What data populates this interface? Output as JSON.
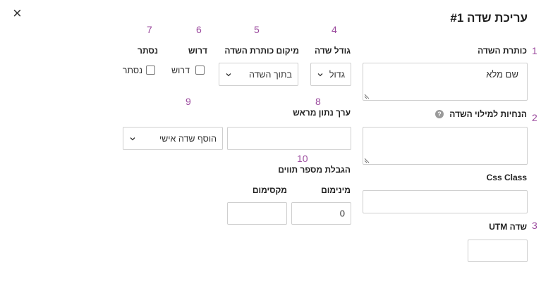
{
  "dialog": {
    "title": "עריכת שדה #1",
    "close_glyph": "×"
  },
  "markers": {
    "m1": "1",
    "m2": "2",
    "m3": "3",
    "m4": "4",
    "m5": "5",
    "m6": "6",
    "m7": "7",
    "m8": "8",
    "m9": "9",
    "m10": "10"
  },
  "fields": {
    "field_title": {
      "label": "כותרת השדה",
      "value": "שם מלא"
    },
    "instructions": {
      "label": "הנחיות למילוי השדה",
      "value": "",
      "help_glyph": "?"
    },
    "css_class": {
      "label": "Css Class",
      "value": ""
    },
    "utm": {
      "label": "שדה UTM",
      "value": ""
    },
    "field_size": {
      "label": "גודל שדה",
      "selected": "גדול"
    },
    "title_position": {
      "label": "מיקום כותרת השדה",
      "selected": "בתוך השדה"
    },
    "required": {
      "label": "דרוש",
      "checkbox_label": "דרוש",
      "checked": false
    },
    "hidden": {
      "label": "נסתר",
      "checkbox_label": "נסתר",
      "checked": false
    },
    "default_value": {
      "label": "ערך נתון מראש",
      "value": ""
    },
    "personal_field": {
      "selected": "הוסף שדה אישי"
    },
    "char_limit": {
      "label": "הגבלת מספר תווים",
      "min_label": "מינימום",
      "min_value": "0",
      "max_label": "מקסימום",
      "max_value": ""
    }
  },
  "colors": {
    "marker": "#9b4a9e",
    "border": "#cfcfcf"
  },
  "icons": {
    "close": "close-icon",
    "chevron": "chevron-down-icon",
    "help": "help-icon",
    "resize": "resize-handle-icon"
  }
}
